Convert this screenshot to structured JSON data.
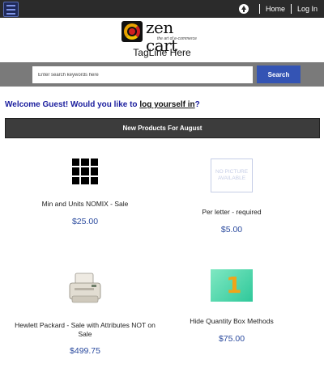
{
  "topnav": {
    "home": "Home",
    "login": "Log In"
  },
  "logo": {
    "name": "zen cart",
    "tagline": "the art of e-commerce"
  },
  "site_tagline": "TagLine Here",
  "search": {
    "placeholder": "Enter search keywords here",
    "button": "Search"
  },
  "welcome": {
    "prefix": "Welcome Guest! Would you like to ",
    "link": "log yourself in",
    "suffix": "?"
  },
  "section_title": "New Products For August",
  "products": [
    {
      "name": "Min and Units NOMIX - Sale",
      "price": "$25.00",
      "image_icon": "grid-icon"
    },
    {
      "name": "Per letter - required",
      "price": "$5.00",
      "image_icon": "no-picture",
      "image_text": "NO PICTURE AVAILABLE"
    },
    {
      "name": "Hewlett Packard - Sale with Attributes NOT on Sale",
      "price": "$499.75",
      "image_icon": "printer-icon"
    },
    {
      "name": "Hide Quantity Box Methods",
      "price": "$75.00",
      "image_icon": "number-one-box",
      "image_text": "1"
    }
  ],
  "colors": {
    "topbar": "#2b2b2b",
    "search_bar": "#7a7a7a",
    "search_button": "#3454b4",
    "welcome_text": "#1b1e9e",
    "heading_bar": "#3c3c3c",
    "price": "#2a4a9e"
  }
}
